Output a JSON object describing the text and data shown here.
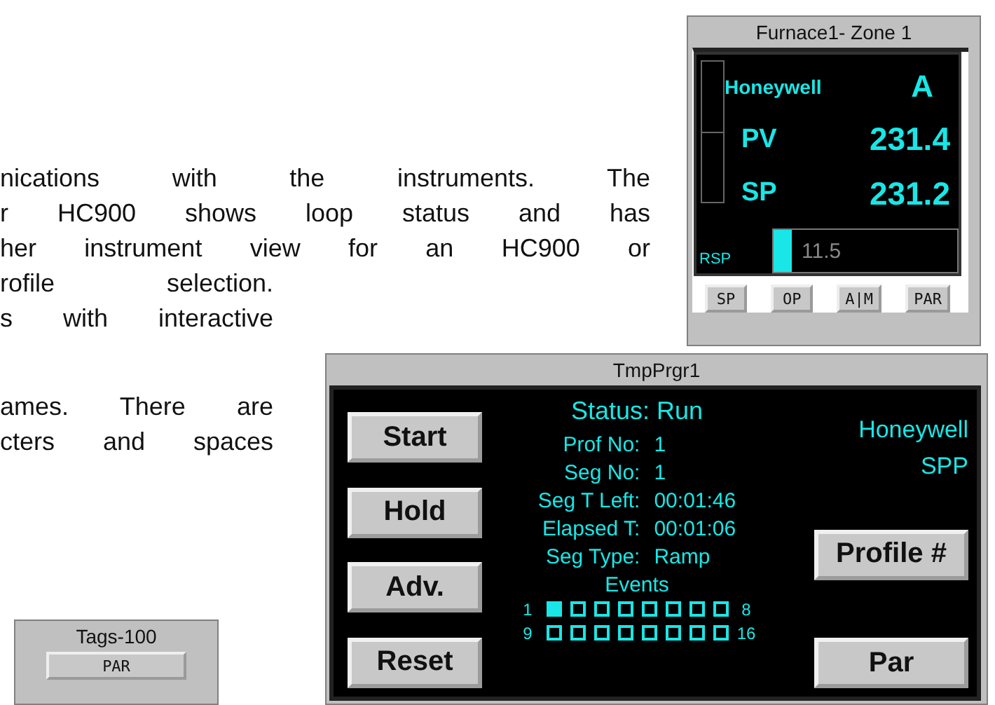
{
  "document_text": {
    "paragraphs": [
      {
        "lines": [
          "nications with the instruments. The",
          "r HC900 shows loop status and has",
          "her instrument view for an HC900 or",
          "rofile selection.",
          "s with interactive"
        ]
      },
      {
        "lines": [
          "ames. There are",
          "cters and spaces"
        ]
      }
    ]
  },
  "loop_faceplate": {
    "title": "Furnace1- Zone 1",
    "brand": "Honeywell",
    "mode": "A",
    "pv_label": "PV",
    "pv": "231.4",
    "sp_label": "SP",
    "sp": "231.2",
    "rsp_label": "RSP",
    "output": {
      "reading": "11.5",
      "level": 0.1
    },
    "buttons": [
      "SP",
      "OP",
      "A|M",
      "PAR"
    ]
  },
  "programmer": {
    "title": "TmpPrgr1",
    "status_label": "Status:",
    "status": "Run",
    "fields": [
      {
        "label": "Prof No:",
        "value": "1"
      },
      {
        "label": "Seg No:",
        "value": "1"
      },
      {
        "label": "Seg T Left:",
        "value": "00:01:46"
      },
      {
        "label": "Elapsed T:",
        "value": "00:01:06"
      },
      {
        "label": "Seg Type:",
        "value": "Ramp"
      }
    ],
    "brand": "Honeywell",
    "model": "SPP",
    "events_label": "Events",
    "event_rows": [
      {
        "start": "1",
        "end": "8",
        "events": [
          true,
          false,
          false,
          false,
          false,
          false,
          false,
          false
        ]
      },
      {
        "start": "9",
        "end": "16",
        "events": [
          false,
          false,
          false,
          false,
          false,
          false,
          false,
          false
        ]
      }
    ],
    "left_buttons": [
      "Start",
      "Hold",
      "Adv.",
      "Reset"
    ],
    "right_buttons": [
      "Profile #",
      "Par"
    ]
  },
  "tags": {
    "title": "Tags-100",
    "buttons": [
      "PAR"
    ]
  }
}
